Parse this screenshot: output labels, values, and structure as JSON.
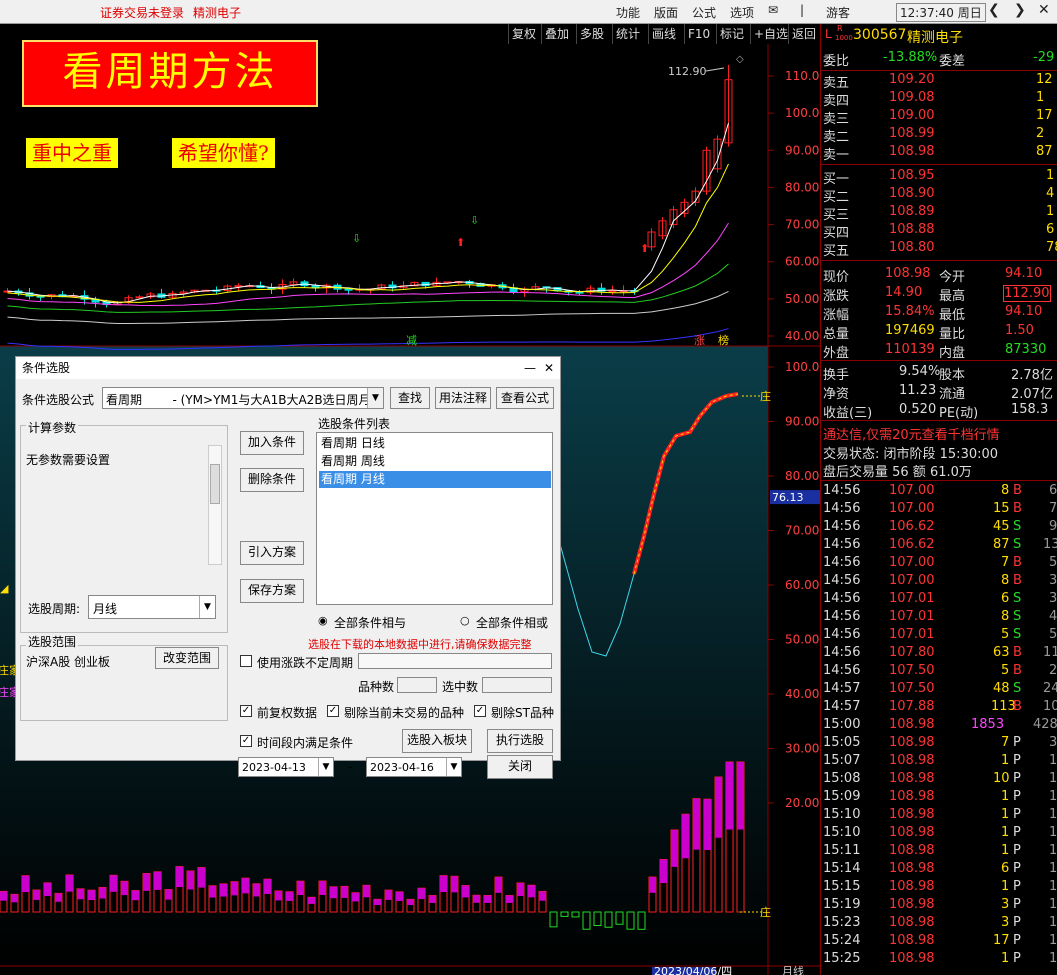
{
  "topbar": {
    "status": "证券交易未登录",
    "stock_name": "精测电子",
    "menus": [
      "功能",
      "版面",
      "公式",
      "选项"
    ],
    "user": "游客",
    "clock": "12:37:40 周日"
  },
  "toolbar": [
    "复权",
    "叠加",
    "多股",
    "统计",
    "画线",
    "F10",
    "标记",
    "+自选",
    "返回"
  ],
  "chart": {
    "banner": "看周期方法",
    "tags": [
      "重中之重",
      "希望你懂?"
    ],
    "price_max_label": "112.90",
    "price_axis": [
      "110.00",
      "100.00",
      "90.00",
      "80.00",
      "70.00",
      "60.00",
      "50.00",
      "40.00"
    ],
    "indicator_axis": [
      "100.00",
      "90.00",
      "80.00",
      "70.00",
      "60.00",
      "50.00",
      "40.00",
      "30.00",
      "20.00"
    ],
    "indicator_value": "76.13",
    "date_label": "2023/04/06/四",
    "period_label": "月线",
    "markers": [
      "减",
      "涨",
      "榜"
    ],
    "zhuang": "庄",
    "zhuangjia": "庄家",
    "colors": {
      "bg": "#000000",
      "up": "#ff2020",
      "down": "#00e0e0",
      "ma1": "#ffffff",
      "ma2": "#ffff00",
      "ma3": "#ff44ff",
      "ma4": "#22cc22",
      "ma5": "#cccccc",
      "ma6": "#3333ff"
    }
  },
  "quote": {
    "code": "300567",
    "name": "精测电子",
    "badge_l": "L",
    "badge_r": "R",
    "badge_sub": "1000",
    "weibi_label": "委比",
    "weibi": "-13.88%",
    "weicha_label": "委差",
    "weicha": "-29",
    "sells": [
      {
        "label": "卖五",
        "price": "109.20",
        "vol": "12"
      },
      {
        "label": "卖四",
        "price": "109.08",
        "vol": "1"
      },
      {
        "label": "卖三",
        "price": "109.00",
        "vol": "17"
      },
      {
        "label": "卖二",
        "price": "108.99",
        "vol": "2"
      },
      {
        "label": "卖一",
        "price": "108.98",
        "vol": "87"
      }
    ],
    "buys": [
      {
        "label": "买一",
        "price": "108.95",
        "vol": "1"
      },
      {
        "label": "买二",
        "price": "108.90",
        "vol": "4"
      },
      {
        "label": "买三",
        "price": "108.89",
        "vol": "1"
      },
      {
        "label": "买四",
        "price": "108.88",
        "vol": "6"
      },
      {
        "label": "买五",
        "price": "108.80",
        "vol": "78"
      }
    ],
    "stats": [
      {
        "l1": "现价",
        "v1": "108.98",
        "l2": "今开",
        "v2": "94.10",
        "c1": "red",
        "c2": "red"
      },
      {
        "l1": "涨跌",
        "v1": "14.90",
        "l2": "最高",
        "v2": "112.90",
        "c1": "red",
        "c2": "red"
      },
      {
        "l1": "涨幅",
        "v1": "15.84%",
        "l2": "最低",
        "v2": "94.10",
        "c1": "red",
        "c2": "red"
      },
      {
        "l1": "总量",
        "v1": "197469",
        "l2": "量比",
        "v2": "1.50",
        "c1": "yel",
        "c2": "red"
      },
      {
        "l1": "外盘",
        "v1": "110139",
        "l2": "内盘",
        "v2": "87330",
        "c1": "red",
        "c2": "grn"
      }
    ],
    "stats2": [
      {
        "l1": "换手",
        "v1": "9.54%",
        "l2": "股本",
        "v2": "2.78亿"
      },
      {
        "l1": "净资",
        "v1": "11.23",
        "l2": "流通",
        "v2": "2.07亿"
      },
      {
        "l1": "收益(三)",
        "v1": "0.520",
        "l2": "PE(动)",
        "v2": "158.3"
      }
    ],
    "ad": "通达信,仅需20元查看千档行情",
    "trade_status": "交易状态: 闭市阶段 15:30:00",
    "after_hours": "盘后交易量 56 额 61.0万",
    "ticks": [
      {
        "t": "14:56",
        "p": "107.00",
        "v": "8",
        "d": "B",
        "n": "6"
      },
      {
        "t": "14:56",
        "p": "107.00",
        "v": "15",
        "d": "B",
        "n": "7"
      },
      {
        "t": "14:56",
        "p": "106.62",
        "v": "45",
        "d": "S",
        "n": "9"
      },
      {
        "t": "14:56",
        "p": "106.62",
        "v": "87",
        "d": "S",
        "n": "13"
      },
      {
        "t": "14:56",
        "p": "107.00",
        "v": "7",
        "d": "B",
        "n": "5"
      },
      {
        "t": "14:56",
        "p": "107.00",
        "v": "8",
        "d": "B",
        "n": "3"
      },
      {
        "t": "14:56",
        "p": "107.01",
        "v": "6",
        "d": "S",
        "n": "3"
      },
      {
        "t": "14:56",
        "p": "107.01",
        "v": "8",
        "d": "S",
        "n": "4"
      },
      {
        "t": "14:56",
        "p": "107.01",
        "v": "5",
        "d": "S",
        "n": "5"
      },
      {
        "t": "14:56",
        "p": "107.80",
        "v": "63",
        "d": "B",
        "n": "11"
      },
      {
        "t": "14:56",
        "p": "107.50",
        "v": "5",
        "d": "B",
        "n": "2"
      },
      {
        "t": "14:57",
        "p": "107.50",
        "v": "48",
        "d": "S",
        "n": "24"
      },
      {
        "t": "14:57",
        "p": "107.88",
        "v": "113",
        "d": "B",
        "n": "10"
      },
      {
        "t": "15:00",
        "p": "108.98",
        "v": "1853",
        "d": "",
        "n": "428"
      },
      {
        "t": "15:05",
        "p": "108.98",
        "v": "7",
        "d": "P",
        "n": "3"
      },
      {
        "t": "15:07",
        "p": "108.98",
        "v": "1",
        "d": "P",
        "n": "1"
      },
      {
        "t": "15:08",
        "p": "108.98",
        "v": "10",
        "d": "P",
        "n": "1"
      },
      {
        "t": "15:09",
        "p": "108.98",
        "v": "1",
        "d": "P",
        "n": "1"
      },
      {
        "t": "15:10",
        "p": "108.98",
        "v": "1",
        "d": "P",
        "n": "1"
      },
      {
        "t": "15:10",
        "p": "108.98",
        "v": "1",
        "d": "P",
        "n": "1"
      },
      {
        "t": "15:11",
        "p": "108.98",
        "v": "1",
        "d": "P",
        "n": "1"
      },
      {
        "t": "15:14",
        "p": "108.98",
        "v": "6",
        "d": "P",
        "n": "1"
      },
      {
        "t": "15:15",
        "p": "108.98",
        "v": "1",
        "d": "P",
        "n": "1"
      },
      {
        "t": "15:19",
        "p": "108.98",
        "v": "3",
        "d": "P",
        "n": "1"
      },
      {
        "t": "15:23",
        "p": "108.98",
        "v": "3",
        "d": "P",
        "n": "1"
      },
      {
        "t": "15:24",
        "p": "108.98",
        "v": "17",
        "d": "P",
        "n": "1"
      },
      {
        "t": "15:25",
        "p": "108.98",
        "v": "1",
        "d": "P",
        "n": "1"
      }
    ]
  },
  "dialog": {
    "title": "条件选股",
    "formula_label": "条件选股公式",
    "formula_value": "看周期        - (YM>YM1与大A1B大A2B选日周月",
    "btn_find": "查找",
    "btn_usage": "用法注释",
    "btn_view": "查看公式",
    "params_group": "计算参数",
    "params_text": "无参数需要设置",
    "btn_add": "加入条件",
    "btn_delete": "删除条件",
    "btn_import": "引入方案",
    "btn_save": "保存方案",
    "list_label": "选股条件列表",
    "conditions": [
      "看周期  日线",
      "看周期  周线",
      "看周期  月线"
    ],
    "selected_index": 2,
    "period_label": "选股周期:",
    "period_value": "月线",
    "radio_and": "全部条件相与",
    "radio_or": "全部条件相或",
    "warning": "选股在下载的本地数据中进行,请确保数据完整",
    "range_group": "选股范围",
    "range_value": "沪深A股 创业板",
    "btn_change": "改变范围",
    "use_range_label": "使用涨跌不定周期",
    "count_label": "品种数",
    "selected_count_label": "选中数",
    "chk_fuquan": "前复权数据",
    "chk_exclude_untraded": "剔除当前未交易的品种",
    "chk_exclude_st": "剔除ST品种",
    "chk_timerange": "时间段内满足条件",
    "btn_to_block": "选股入板块",
    "btn_run": "执行选股",
    "btn_close": "关闭",
    "date_from": "2023-04-13",
    "date_to": "2023-04-16",
    "date_dash": "-"
  }
}
